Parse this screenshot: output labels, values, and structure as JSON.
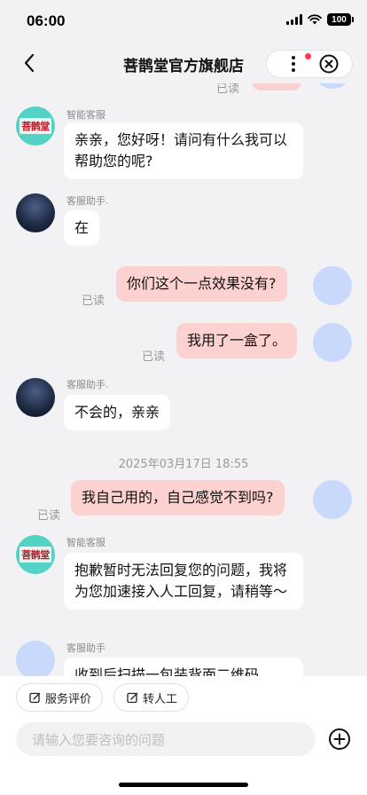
{
  "status_bar": {
    "time": "06:00",
    "battery": "100"
  },
  "header": {
    "title": "菩鹊堂官方旗舰店"
  },
  "avatars": {
    "brand_text": "菩鹊堂"
  },
  "chat": {
    "top_read": "已读",
    "messages": [
      {
        "sender": "智能客服",
        "text": "亲亲，您好呀！请问有什么我可以帮助您的呢?"
      },
      {
        "sender": "客服助手.",
        "text": "在"
      },
      {
        "text": "你们这个一点效果没有?",
        "read": "已读"
      },
      {
        "text": "我用了一盒了。",
        "read": "已读"
      },
      {
        "sender": "客服助手.",
        "text": "不会的，亲亲"
      },
      {
        "timestamp": "2025年03月17日 18:55"
      },
      {
        "text": "我自己用的，自己感觉不到吗?",
        "read": "已读"
      },
      {
        "sender": "智能客服",
        "text": "抱歉暂时无法回复您的问题，我将为您加速接入人工回复，请稍等～"
      },
      {
        "sender": "客服助手",
        "text": "收到后扫描一包装背面二维码"
      }
    ]
  },
  "bottom": {
    "quick_actions": [
      "服务评价",
      "转人工"
    ],
    "input_placeholder": "请输入您要咨询的问题"
  }
}
